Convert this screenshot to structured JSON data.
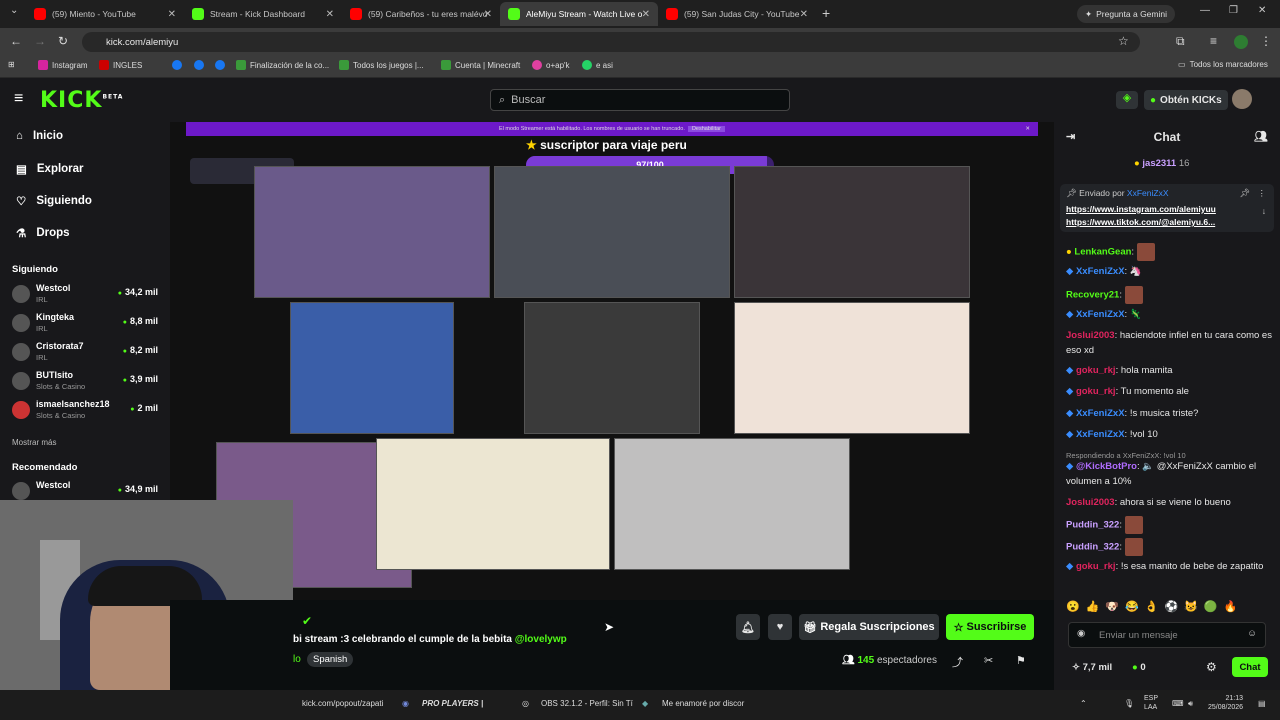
{
  "browser": {
    "tabs": [
      {
        "label": "(59) Miento - YouTube",
        "icon": "youtube-icon"
      },
      {
        "label": "Stream - Kick Dashboard",
        "icon": "kick-icon"
      },
      {
        "label": "(59) Caribeños - tu eres malévo",
        "icon": "youtube-icon"
      },
      {
        "label": "AleMiyu Stream - Watch Live o",
        "icon": "kick-icon"
      },
      {
        "label": "(59) San Judas City - YouTube",
        "icon": "youtube-icon"
      }
    ],
    "gemini_label": "Pregunta a Gemini",
    "url": "kick.com/alemiyu",
    "bookmarks": [
      "Instagram",
      "INGLES",
      "",
      "",
      "",
      "Finalización de la co...",
      "Todos los juegos |...",
      "Cuenta | Minecraft",
      "o+ap'k",
      "e asi"
    ],
    "all_bookmarks": "Todos los marcadores"
  },
  "header": {
    "logo": "KICK",
    "logo_badge": "BETA",
    "search_placeholder": "Buscar",
    "get_kicks": "Obtén KICKs"
  },
  "sidebar": {
    "nav": [
      "Inicio",
      "Explorar",
      "Siguiendo",
      "Drops"
    ],
    "following_title": "Siguiendo",
    "following": [
      {
        "name": "Westcol",
        "category": "IRL",
        "viewers": "34,2 mil"
      },
      {
        "name": "Kingteka",
        "category": "IRL",
        "viewers": "8,8 mil"
      },
      {
        "name": "Cristorata7",
        "category": "IRL",
        "viewers": "8,2 mil"
      },
      {
        "name": "BUTIsito",
        "category": "Slots & Casino",
        "viewers": "3,9 mil"
      },
      {
        "name": "ismaelsanchez18",
        "category": "Slots & Casino",
        "viewers": "2 mil"
      }
    ],
    "show_more": "Mostrar más",
    "recommended_title": "Recomendado",
    "recommended": [
      {
        "name": "Westcol",
        "viewers": "34,9 mil"
      }
    ]
  },
  "video": {
    "banner": "El modo Streamer está habilitado. Los nombres de usuario se han truncado.",
    "banner_action": "Deshabilitar",
    "goal_title": "suscriptor para viaje peru",
    "goal_progress": "97/100",
    "goal_fraction": 0.97
  },
  "stream_info": {
    "title": "bi stream :3 celebrando el cumple de la bebita",
    "mention": "@lovelywp",
    "category_fragment": "lo",
    "language_tag": "Spanish",
    "gift_subs": "Regala Suscripciones",
    "subscribe": "Suscribirse",
    "viewers_count": "145",
    "viewers_label": "espectadores"
  },
  "chat": {
    "title": "Chat",
    "top_gifter": "jas2311",
    "top_gifter_count": "16",
    "pinned_by_label": "Enviado por",
    "pinned_by": "XxFeniZxX",
    "pinned_line1": "https://www.instagram.com/alemiyuu",
    "pinned_line2": "https://www.tiktok.com/@alemiyu.6...",
    "messages": [
      {
        "user": "LenkanGean",
        "text": "",
        "color": "#53fc18"
      },
      {
        "user": "XxFeniZxX",
        "text": "",
        "color": "#3a8dff"
      },
      {
        "user": "Recovery21",
        "text": "",
        "color": "#53fc18"
      },
      {
        "user": "XxFeniZxX",
        "text": "",
        "color": "#3a8dff"
      },
      {
        "user": "Joslui2003",
        "text": "haciendote infiel en tu cara como es eso xd",
        "color": "#e0245e"
      },
      {
        "user": "goku_rkj",
        "text": "hola mamita",
        "color": "#e0245e"
      },
      {
        "user": "goku_rkj",
        "text": "Tu momento ale",
        "color": "#e0245e"
      },
      {
        "user": "XxFeniZxX",
        "text": "!s musica triste?",
        "color": "#3a8dff"
      },
      {
        "user": "XxFeniZxX",
        "text": "!vol 10",
        "color": "#3a8dff"
      },
      {
        "user": "@KickBotPro",
        "text": "🔈 @XxFeniZxX cambio el volumen a 10%",
        "color": "#b06cff"
      },
      {
        "user": "Joslui2003",
        "text": "ahora si se viene lo bueno",
        "color": "#e0245e"
      },
      {
        "user": "Puddin_322",
        "text": "",
        "color": "#c9a0ff"
      },
      {
        "user": "Puddin_322",
        "text": "",
        "color": "#c9a0ff"
      },
      {
        "user": "goku_rkj",
        "text": "!s esa manito de bebe de zapatito",
        "color": "#e0245e"
      }
    ],
    "reply_hint": "Respondiendo a XxFeniZxX: !vol 10",
    "input_placeholder": "Enviar un mensaje",
    "footer_count": "7,7 mil",
    "footer_kicks": "0",
    "chat_button": "Chat"
  },
  "taskbar": {
    "items": [
      "kick.com/popout/zapati",
      "PRO PLAYERS |",
      "OBS 32.1.2 - Perfil: Sin Tí",
      "Me enamoré por discor"
    ],
    "lang": "ESP",
    "lang2": "LAA",
    "time": "21:13",
    "date": "25/08/2026"
  }
}
